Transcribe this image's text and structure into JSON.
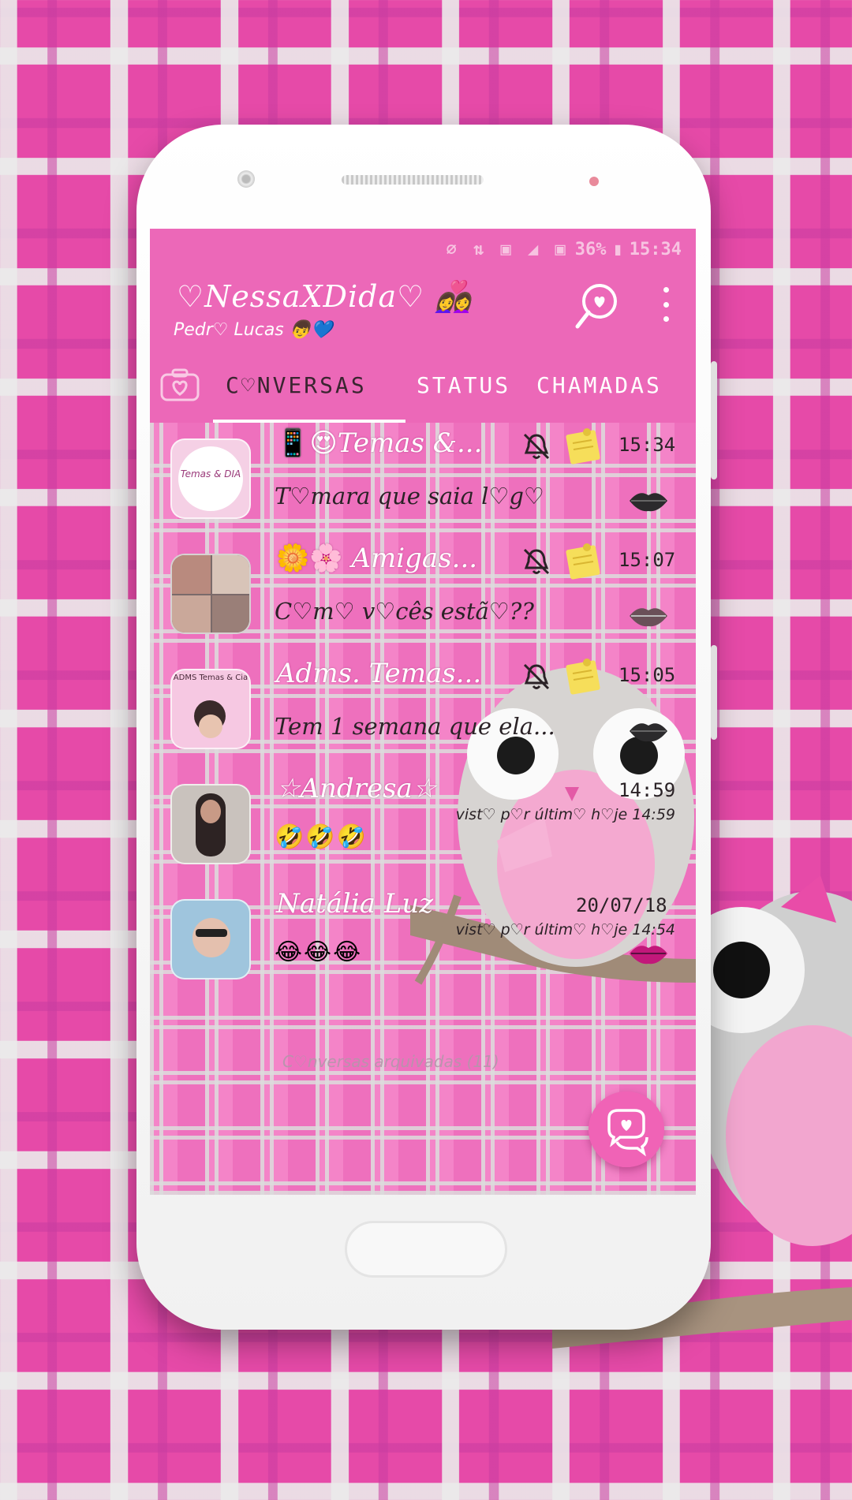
{
  "status_bar": {
    "icons": "⌀ ⇅ ▣ ◢ ▣",
    "battery": "36%",
    "time": "15:34"
  },
  "header": {
    "title": "♡NessaXDida♡ 👩‍❤️‍👩",
    "subtitle": "Pedr♡ Lucas 👦💙"
  },
  "tabs": [
    {
      "label": "C♡NVERSAS",
      "active": true
    },
    {
      "label": "STATUS",
      "active": false
    },
    {
      "label": "CHAMADAS",
      "active": false
    }
  ],
  "chats": [
    {
      "name": "Temas &...",
      "lead_emoji": "📱😍",
      "time": "15:34",
      "message": "T♡mara que saia l♡g♡",
      "muted": true,
      "avatar_text": "Temas & DIA"
    },
    {
      "name": "Amigas...",
      "lead_emoji": "🌼🌸",
      "time": "15:07",
      "message": "C♡m♡ v♡cês estã♡??",
      "muted": true
    },
    {
      "name": "Adms. Temas...",
      "lead_emoji": "",
      "time": "15:05",
      "message": "Tem 1 semana que ela...",
      "muted": true,
      "avatar_text": "ADMS Temas & Cia"
    },
    {
      "name": "☆Andresa☆",
      "time": "14:59",
      "seen": "vist♡ p♡r últim♡ h♡je 14:59",
      "reaction": "🤣🤣🤣"
    },
    {
      "name": "Natália Luz",
      "time": "20/07/18",
      "seen": "vist♡ p♡r últim♡ h♡je 14:54",
      "reaction": "😂😂😂"
    }
  ],
  "archived_label": "C♡nversas arquivadas (11)",
  "colors": {
    "primary": "#ec68b8",
    "accent": "#f063b6",
    "text_dark": "#2a2226"
  }
}
